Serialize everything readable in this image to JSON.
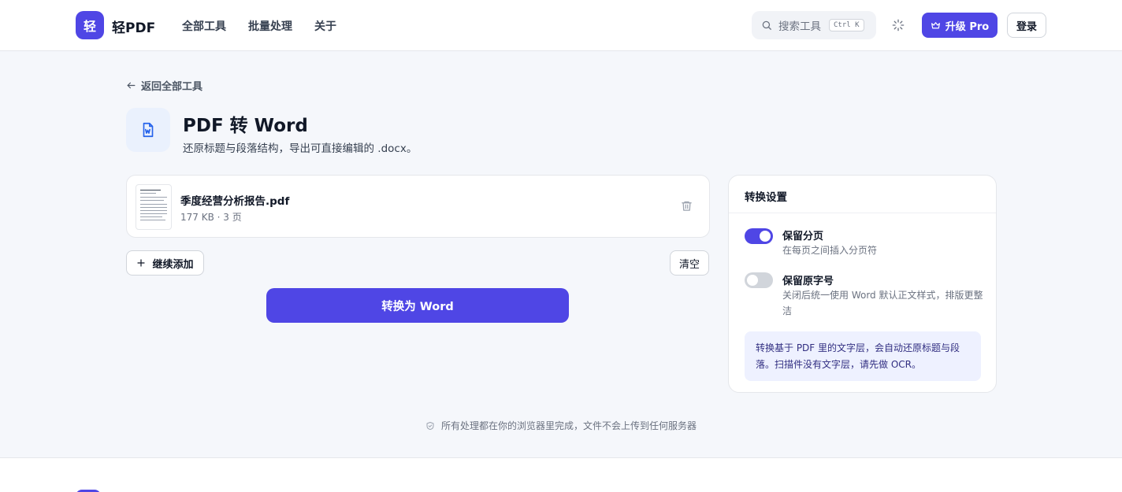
{
  "header": {
    "logo_char": "轻",
    "brand": "轻PDF",
    "nav": [
      "全部工具",
      "批量处理",
      "关于"
    ],
    "search_label": "搜索工具",
    "search_shortcut": "Ctrl K",
    "upgrade_label": "升级 Pro",
    "login_label": "登录"
  },
  "page": {
    "back_label": "返回全部工具",
    "title": "PDF 转 Word",
    "subtitle": "还原标题与段落结构，导出可直接编辑的 .docx。"
  },
  "file": {
    "name": "季度经营分析报告.pdf",
    "meta": "177 KB · 3 页"
  },
  "actions": {
    "add_label": "继续添加",
    "clear_label": "清空",
    "convert_label": "转换为 Word"
  },
  "settings": {
    "title": "转换设置",
    "options": [
      {
        "label": "保留分页",
        "desc": "在每页之间插入分页符",
        "on": true
      },
      {
        "label": "保留原字号",
        "desc": "关闭后统一使用 Word 默认正文样式，排版更整洁",
        "on": false
      }
    ],
    "note": "转换基于 PDF 里的文字层，会自动还原标题与段落。扫描件没有文字层，请先做 OCR。"
  },
  "footer": {
    "privacy": "所有处理都在你的浏览器里完成，文件不会上传到任何服务器"
  },
  "colors": {
    "accent": "#4f46e5",
    "toggle_off": "#d1d5db"
  }
}
